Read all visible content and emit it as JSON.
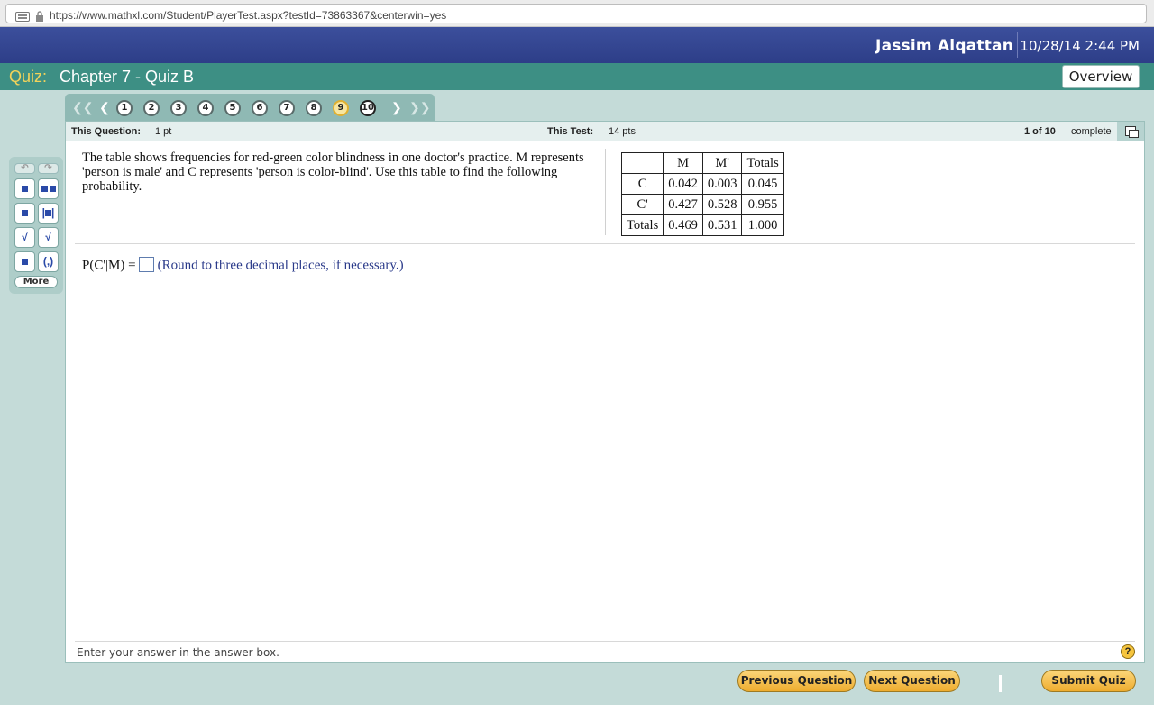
{
  "browser": {
    "url": "https://www.mathxl.com/Student/PlayerTest.aspx?testId=73863367&centerwin=yes"
  },
  "header": {
    "user_name": "Jassim Alqattan",
    "datetime": "10/28/14 2:44 PM"
  },
  "quiz": {
    "label": "Quiz:",
    "title": "Chapter 7 - Quiz B",
    "overview_label": "Overview"
  },
  "nav": {
    "questions": [
      "1",
      "2",
      "3",
      "4",
      "5",
      "6",
      "7",
      "8",
      "9",
      "10"
    ],
    "current": "9",
    "icons": {
      "first": "double-left-arrow-icon",
      "prev": "left-arrow-icon",
      "next": "right-arrow-icon",
      "last": "double-right-arrow-icon"
    }
  },
  "info": {
    "this_question_label": "This Question:",
    "this_question_value": "1 pt",
    "this_test_label": "This Test:",
    "this_test_value": "14 pts",
    "progress": "1 of 10",
    "complete_label": "complete"
  },
  "question": {
    "text": "The table shows frequencies for red-green color blindness in one doctor's practice. M represents 'person is male' and C represents 'person is color-blind'. Use this table to find the following  probability.",
    "table": {
      "headers": [
        "",
        "M",
        "M'",
        "Totals"
      ],
      "rows": [
        [
          "C",
          "0.042",
          "0.003",
          "0.045"
        ],
        [
          "C'",
          "0.427",
          "0.528",
          "0.955"
        ],
        [
          "Totals",
          "0.469",
          "0.531",
          "1.000"
        ]
      ]
    },
    "answer_prefix": "P(C'|M) =",
    "answer_value": "",
    "answer_hint": "(Round to three decimal places, if necessary.)"
  },
  "footer": {
    "instruction": "Enter your answer in the answer box.",
    "help_symbol": "?"
  },
  "palette": {
    "more_label": "More"
  },
  "buttons": {
    "previous": "Previous Question",
    "next": "Next Question",
    "submit": "Submit Quiz"
  },
  "colors": {
    "header_blue": "#2d3e88",
    "quiz_teal": "#3d8f84",
    "quiz_label_yellow": "#f2d35a",
    "button_orange": "#eeac2e"
  }
}
